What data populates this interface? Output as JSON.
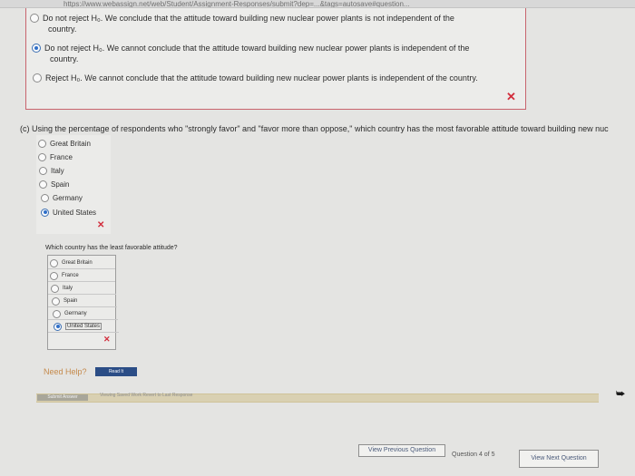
{
  "browser": {
    "url": "https://www.webassign.net/web/Student/Assignment-Responses/submit?dep=...&tags=autosave#question..."
  },
  "previous_part": {
    "options": [
      {
        "lines": [
          "Do not reject H₀. We conclude that the attitude toward building new nuclear power plants is not independent of the",
          "country."
        ],
        "selected": false
      },
      {
        "lines": [
          "Do not reject H₀. We cannot conclude that the attitude toward building new nuclear power plants is independent of the",
          "country."
        ],
        "selected": true
      },
      {
        "lines": [
          "Reject H₀. We cannot conclude that the attitude toward building new nuclear power plants is independent of the country."
        ],
        "selected": false
      }
    ],
    "mark": "✕"
  },
  "part_c": {
    "question": "(c) Using the percentage of respondents who \"strongly favor\" and \"favor more than oppose,\" which country has the most favorable attitude toward building new nuc",
    "options": [
      {
        "label": "Great Britain",
        "selected": false
      },
      {
        "label": "France",
        "selected": false
      },
      {
        "label": "Italy",
        "selected": false
      },
      {
        "label": "Spain",
        "selected": false
      },
      {
        "label": "Germany",
        "selected": false
      },
      {
        "label": "United States",
        "selected": true
      }
    ],
    "mark": "✕"
  },
  "part_c2": {
    "question": "Which country has the least favorable attitude?",
    "options": [
      {
        "label": "Great Britain",
        "selected": false
      },
      {
        "label": "France",
        "selected": false
      },
      {
        "label": "Italy",
        "selected": false
      },
      {
        "label": "Spain",
        "selected": false
      },
      {
        "label": "Germany",
        "selected": false
      },
      {
        "label": "United States",
        "selected": true
      }
    ],
    "mark": "✕"
  },
  "help": {
    "label": "Need Help?",
    "button": "Read It"
  },
  "footer": {
    "submit": "Submit Answer",
    "status": "Viewing Saved Work Revert to Last Response"
  },
  "navigation": {
    "previous": "View Previous Question",
    "question_counter": "Question 4 of 5",
    "next": "View Next Question"
  },
  "colors": {
    "wrong": "#d22d3c",
    "selected": "#2f6fc8",
    "link_button": "#2b4d86"
  }
}
